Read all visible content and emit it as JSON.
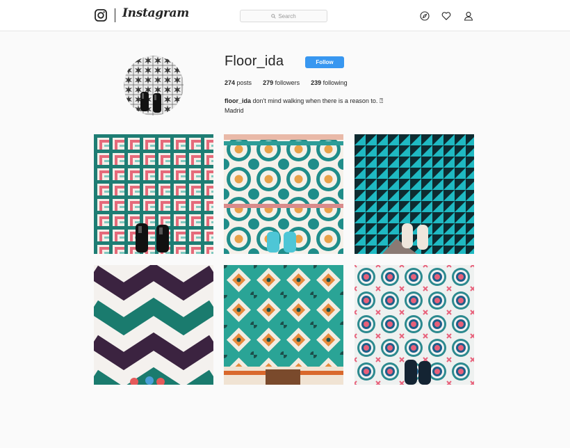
{
  "header": {
    "wordmark": "Instagram",
    "search_placeholder": "Search"
  },
  "profile": {
    "username": "Floor_ida",
    "follow_label": "Follow",
    "posts_count": "274",
    "posts_label": "posts",
    "followers_count": "279",
    "followers_label": "followers",
    "following_count": "239",
    "following_label": "following",
    "bio_handle": "floor_ida",
    "bio_text": "don't mind walking when there is a reason to. ⍰",
    "bio_location": "Madrid"
  },
  "posts": [
    {
      "name": "teal-pink-maze-tiles-with-black-shoes"
    },
    {
      "name": "teal-ornamental-tiles-with-sneakers"
    },
    {
      "name": "turquoise-triangle-tiles-with-white-sneakers"
    },
    {
      "name": "purple-teal-chevron-tiles"
    },
    {
      "name": "teal-orange-geometric-tiles"
    },
    {
      "name": "pink-teal-circle-tiles-with-dark-shoes"
    }
  ],
  "colors": {
    "follow_button": "#3897f0",
    "background": "#fafafa",
    "text": "#262626"
  }
}
